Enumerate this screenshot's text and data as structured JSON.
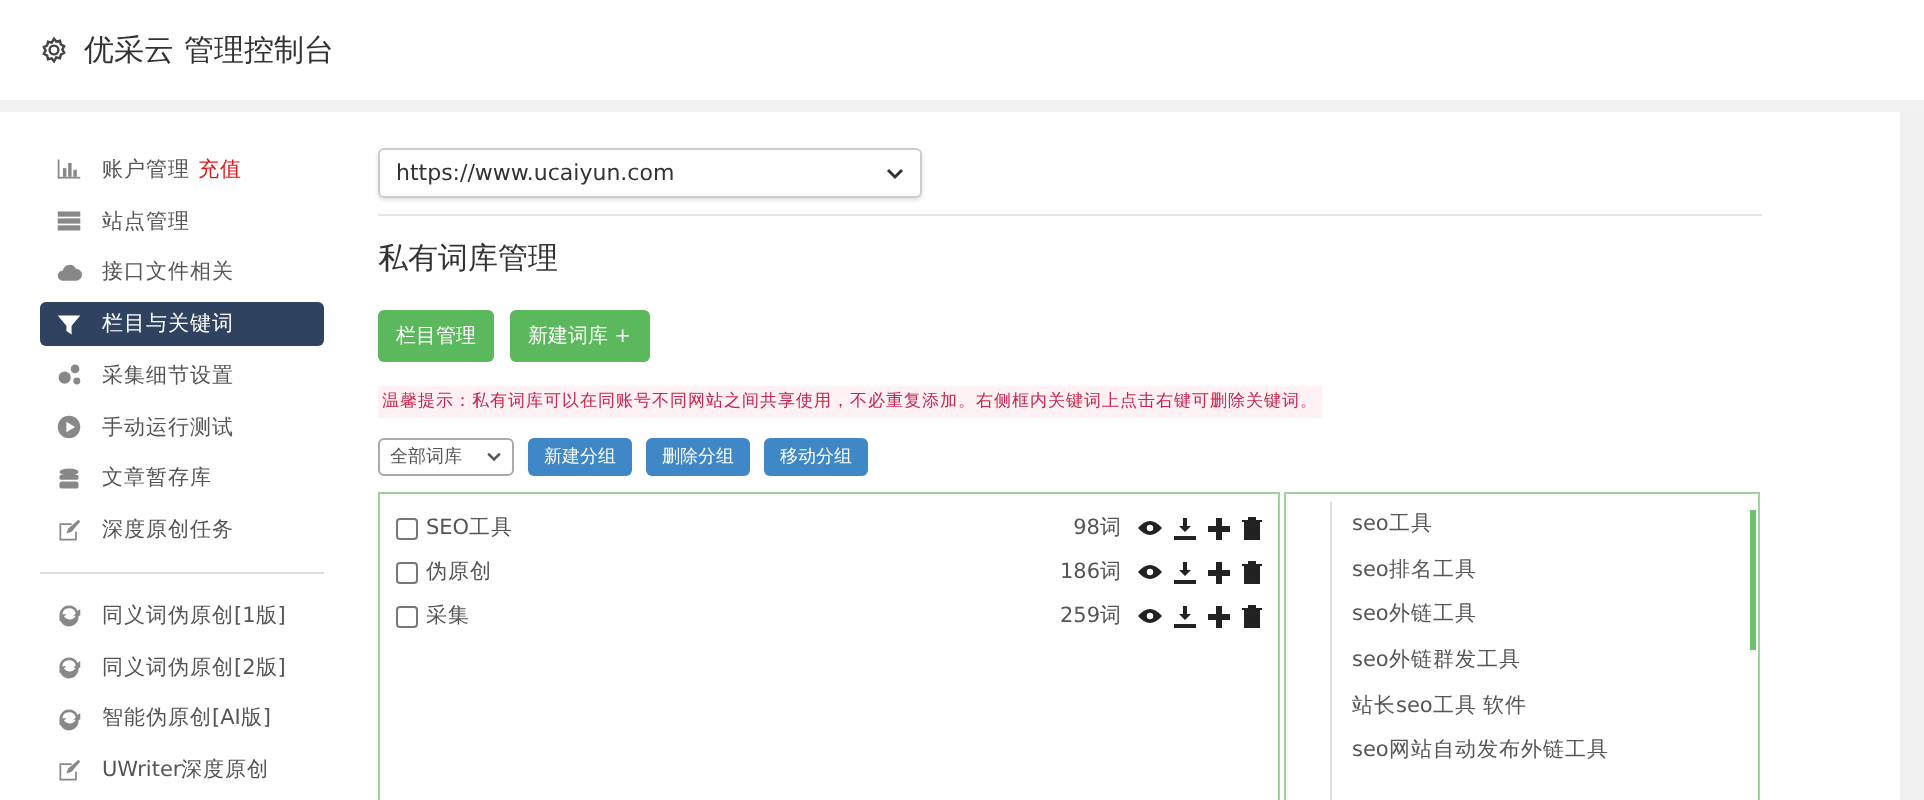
{
  "header": {
    "title": "优采云 管理控制台"
  },
  "sidebar": {
    "items": [
      {
        "label": "账户管理",
        "badge": "充值",
        "selected": false
      },
      {
        "label": "站点管理",
        "selected": false
      },
      {
        "label": "接口文件相关",
        "selected": false
      },
      {
        "label": "栏目与关键词",
        "selected": true
      },
      {
        "label": "采集细节设置",
        "selected": false
      },
      {
        "label": "手动运行测试",
        "selected": false
      },
      {
        "label": "文章暂存库",
        "selected": false
      },
      {
        "label": "深度原创任务",
        "selected": false
      }
    ],
    "tools": [
      {
        "label": "同义词伪原创[1版]"
      },
      {
        "label": "同义词伪原创[2版]"
      },
      {
        "label": "智能伪原创[AI版]"
      },
      {
        "label": "UWriter深度原创"
      }
    ]
  },
  "site_select": {
    "value": "https://www.ucaiyun.com"
  },
  "heading": "私有词库管理",
  "buttons": [
    "栏目管理",
    "新建词库 +"
  ],
  "tip": "温馨提示：私有词库可以在同账号不同网站之间共享使用，不必重复添加。右侧框内关键词上点击右键可删除关键词。",
  "group_select": {
    "value": "全部词库"
  },
  "group_buttons": [
    "新建分组",
    "删除分组",
    "移动分组"
  ],
  "libraries": [
    {
      "name": "SEO工具",
      "count": "98词",
      "checked": false
    },
    {
      "name": "伪原创",
      "count": "186词",
      "checked": false
    },
    {
      "name": "采集",
      "count": "259词",
      "checked": false
    }
  ],
  "keywords": [
    "seo工具",
    "seo排名工具",
    "seo外链工具",
    "seo外链群发工具",
    "站长seo工具 软件",
    "seo网站自动发布外链工具"
  ]
}
